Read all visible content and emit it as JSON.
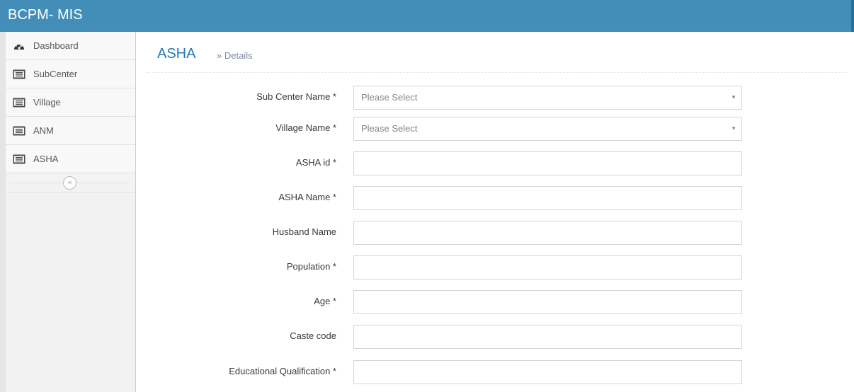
{
  "app": {
    "title": "BCPM- MIS"
  },
  "sidebar": {
    "items": [
      {
        "label": "Dashboard",
        "icon": "tachometer-icon"
      },
      {
        "label": "SubCenter",
        "icon": "list-alt-icon"
      },
      {
        "label": "Village",
        "icon": "list-alt-icon"
      },
      {
        "label": "ANM",
        "icon": "list-alt-icon"
      },
      {
        "label": "ASHA",
        "icon": "list-alt-icon"
      }
    ],
    "collapse_icon": "double-angle-left-icon"
  },
  "page": {
    "title": "ASHA",
    "subtitle": "» Details"
  },
  "form": {
    "sub_center": {
      "label": "Sub Center Name *",
      "value": "Please Select"
    },
    "village": {
      "label": "Village Name *",
      "value": "Please Select"
    },
    "asha_id": {
      "label": "ASHA id *",
      "value": ""
    },
    "asha_name": {
      "label": "ASHA Name *",
      "value": ""
    },
    "husband_name": {
      "label": "Husband Name",
      "value": ""
    },
    "population": {
      "label": "Population *",
      "value": ""
    },
    "age": {
      "label": "Age *",
      "value": ""
    },
    "caste_code": {
      "label": "Caste code",
      "value": ""
    },
    "education": {
      "label": "Educational Qualification *",
      "value": ""
    }
  },
  "colors": {
    "navbar": "#438eb9",
    "accent": "#2679b5"
  }
}
